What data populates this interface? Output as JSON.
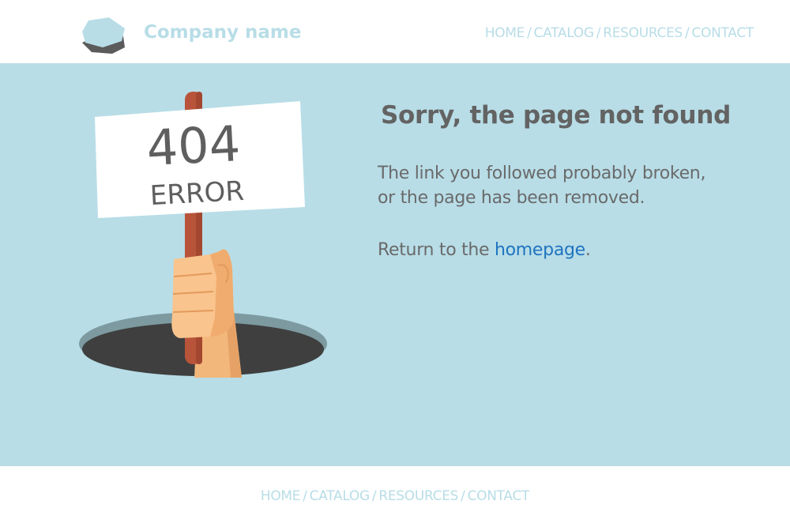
{
  "header": {
    "company_name": "Company name",
    "logo_icon": "hexagon-logo-icon",
    "nav": [
      {
        "label": "HOME"
      },
      {
        "label": "CATALOG"
      },
      {
        "label": "RESOURCES"
      },
      {
        "label": "CONTACT"
      }
    ],
    "separator": "/"
  },
  "main": {
    "sign": {
      "line1": "404",
      "line2": "ERROR"
    },
    "headline": "Sorry, the page not found",
    "description_line1": "The link you followed probably broken,",
    "description_line2": "or the page has been removed.",
    "return_prefix": "Return to the ",
    "return_link": "homepage",
    "return_suffix": "."
  },
  "footer": {
    "nav": [
      {
        "label": "HOME"
      },
      {
        "label": "CATALOG"
      },
      {
        "label": "RESOURCES"
      },
      {
        "label": "CONTACT"
      }
    ],
    "separator": "/"
  },
  "colors": {
    "background": "#b8dde7",
    "accent_text": "#b8dde7",
    "heading": "#636363",
    "body_text": "#6a6a6a",
    "link": "#1f74c0"
  }
}
